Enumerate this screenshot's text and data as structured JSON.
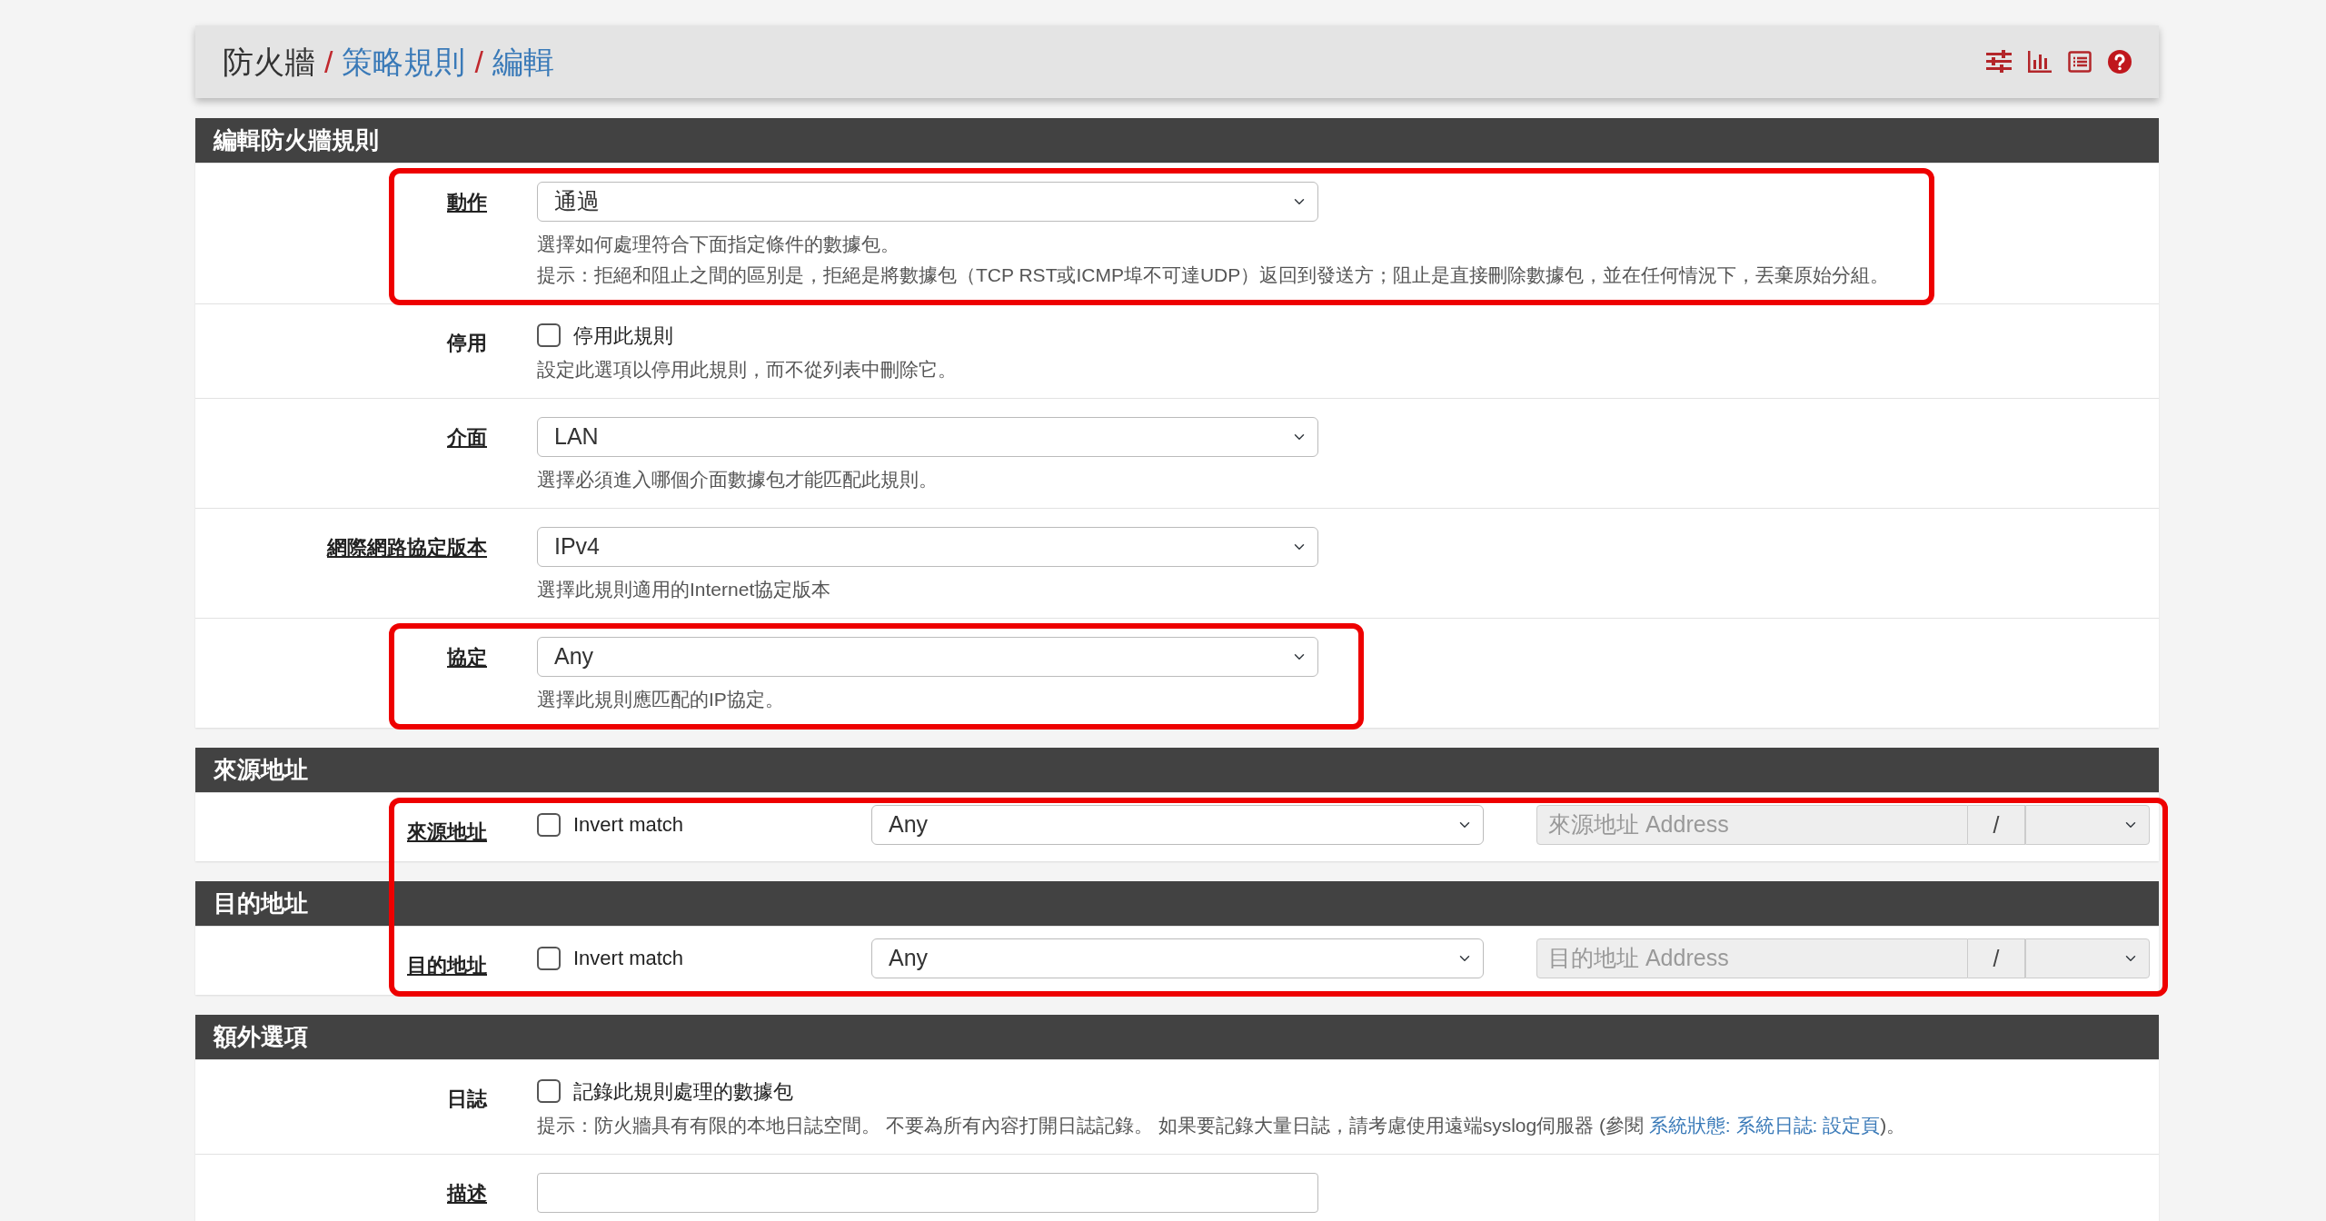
{
  "breadcrumb": [
    {
      "text": "防火牆",
      "link": false
    },
    {
      "separator": "/",
      "text": "策略規則",
      "link": true
    },
    {
      "separator": "/",
      "text": "編輯",
      "link": true
    }
  ],
  "sections": [
    {
      "title": "編輯防火牆規則",
      "rows": [
        {
          "kind": "select",
          "label": "動作",
          "label_underlined": true,
          "value": "通過",
          "hints": [
            "選擇如何處理符合下面指定條件的數據包。",
            "提示：拒絕和阻止之間的區別是，拒絕是將數據包（TCP RST或ICMP埠不可達UDP）返回到發送方；阻止是直接刪除數據包，並在任何情況下，丟棄原始分組。"
          ],
          "highlighted": true
        },
        {
          "kind": "checkbox",
          "label": "停用",
          "label_underlined": false,
          "checked": false,
          "check_label": "停用此規則",
          "hints": [
            "設定此選項以停用此規則，而不從列表中刪除它。"
          ]
        },
        {
          "kind": "select",
          "label": "介面",
          "label_underlined": true,
          "value": "LAN",
          "hints": [
            "選擇必須進入哪個介面數據包才能匹配此規則。"
          ]
        },
        {
          "kind": "select",
          "label": "網際網路協定版本",
          "label_underlined": true,
          "value": "IPv4",
          "hints": [
            "選擇此規則適用的Internet協定版本"
          ]
        },
        {
          "kind": "select",
          "label": "協定",
          "label_underlined": true,
          "value": "Any",
          "hints": [
            "選擇此規則應匹配的IP協定。"
          ],
          "highlighted": true
        }
      ]
    },
    {
      "title": "來源地址",
      "rows": [
        {
          "kind": "address",
          "label": "來源地址",
          "label_underlined": true,
          "checked": false,
          "check_label": "Invert match",
          "value": "Any",
          "placeholder": "來源地址 Address",
          "separator": "/",
          "highlighted": true
        }
      ]
    },
    {
      "title": "目的地址",
      "rows": [
        {
          "kind": "address",
          "label": "目的地址",
          "label_underlined": true,
          "checked": false,
          "check_label": "Invert match",
          "value": "Any",
          "placeholder": "目的地址 Address",
          "separator": "/",
          "highlighted": true
        }
      ]
    },
    {
      "title": "額外選項",
      "rows": [
        {
          "kind": "checkbox",
          "label": "日誌",
          "label_underlined": false,
          "checked": false,
          "check_label": "記錄此規則處理的數據包",
          "hints": [
            {
              "before": "提示：防火牆具有有限的本地日誌空間。 不要為所有內容打開日誌記錄。 如果要記錄大量日誌，請考慮使用遠端syslog伺服器 (參閱 ",
              "link": "系統狀態: 系統日誌: 設定頁",
              "after": ")。"
            }
          ]
        },
        {
          "kind": "text",
          "label": "描述",
          "label_underlined": true
        }
      ]
    }
  ]
}
